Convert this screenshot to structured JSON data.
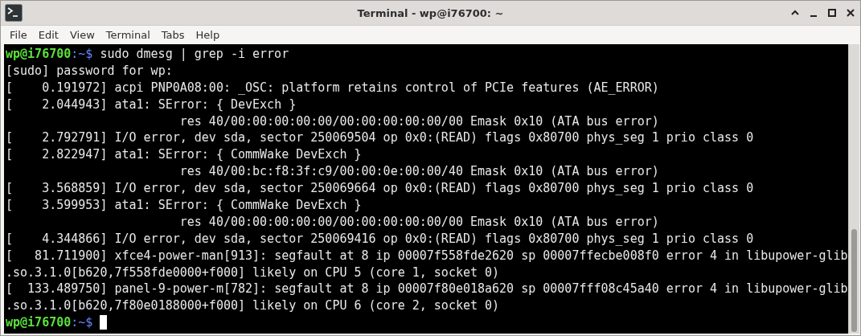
{
  "window": {
    "title": "Terminal - wp@i76700: ~"
  },
  "menu": [
    "File",
    "Edit",
    "View",
    "Terminal",
    "Tabs",
    "Help"
  ],
  "terminal": {
    "lines": [
      {
        "kind": "prompt",
        "user_host": "wp@i76700",
        "path": ":~$",
        "command": "sudo dmesg | grep -i error"
      },
      {
        "kind": "output",
        "text": "[sudo] password for wp:"
      },
      {
        "kind": "output",
        "text": "[    0.191972] acpi PNP0A08:00: _OSC: platform retains control of PCIe features (AE_ERROR)"
      },
      {
        "kind": "output",
        "text": "[    2.044943] ata1: SError: { DevExch }"
      },
      {
        "kind": "output",
        "text": "                        res 40/00:00:00:00:00/00:00:00:00:00/00 Emask 0x10 (ATA bus error)"
      },
      {
        "kind": "output",
        "text": "[    2.792791] I/O error, dev sda, sector 250069504 op 0x0:(READ) flags 0x80700 phys_seg 1 prio class 0"
      },
      {
        "kind": "output",
        "text": "[    2.822947] ata1: SError: { CommWake DevExch }"
      },
      {
        "kind": "output",
        "text": "                        res 40/00:bc:f8:3f:c9/00:00:0e:00:00/40 Emask 0x10 (ATA bus error)"
      },
      {
        "kind": "output",
        "text": "[    3.568859] I/O error, dev sda, sector 250069664 op 0x0:(READ) flags 0x80700 phys_seg 1 prio class 0"
      },
      {
        "kind": "output",
        "text": "[    3.599953] ata1: SError: { CommWake DevExch }"
      },
      {
        "kind": "output",
        "text": "                        res 40/00:00:00:00:00/00:00:00:00:00/00 Emask 0x10 (ATA bus error)"
      },
      {
        "kind": "output",
        "text": "[    4.344866] I/O error, dev sda, sector 250069416 op 0x0:(READ) flags 0x80700 phys_seg 1 prio class 0"
      },
      {
        "kind": "output",
        "text": "[   81.711900] xfce4-power-man[913]: segfault at 8 ip 00007f558fde2620 sp 00007ffecbe008f0 error 4 in libupower-glib"
      },
      {
        "kind": "output",
        "text": ".so.3.1.0[b620,7f558fde0000+f000] likely on CPU 5 (core 1, socket 0)"
      },
      {
        "kind": "output",
        "text": "[  133.489750] panel-9-power-m[782]: segfault at 8 ip 00007f80e018a620 sp 00007fff08c45a40 error 4 in libupower-glib"
      },
      {
        "kind": "output",
        "text": ".so.3.1.0[b620,7f80e0188000+f000] likely on CPU 6 (core 2, socket 0)"
      },
      {
        "kind": "prompt",
        "user_host": "wp@i76700",
        "path": ":~$",
        "cursor": true
      }
    ]
  }
}
